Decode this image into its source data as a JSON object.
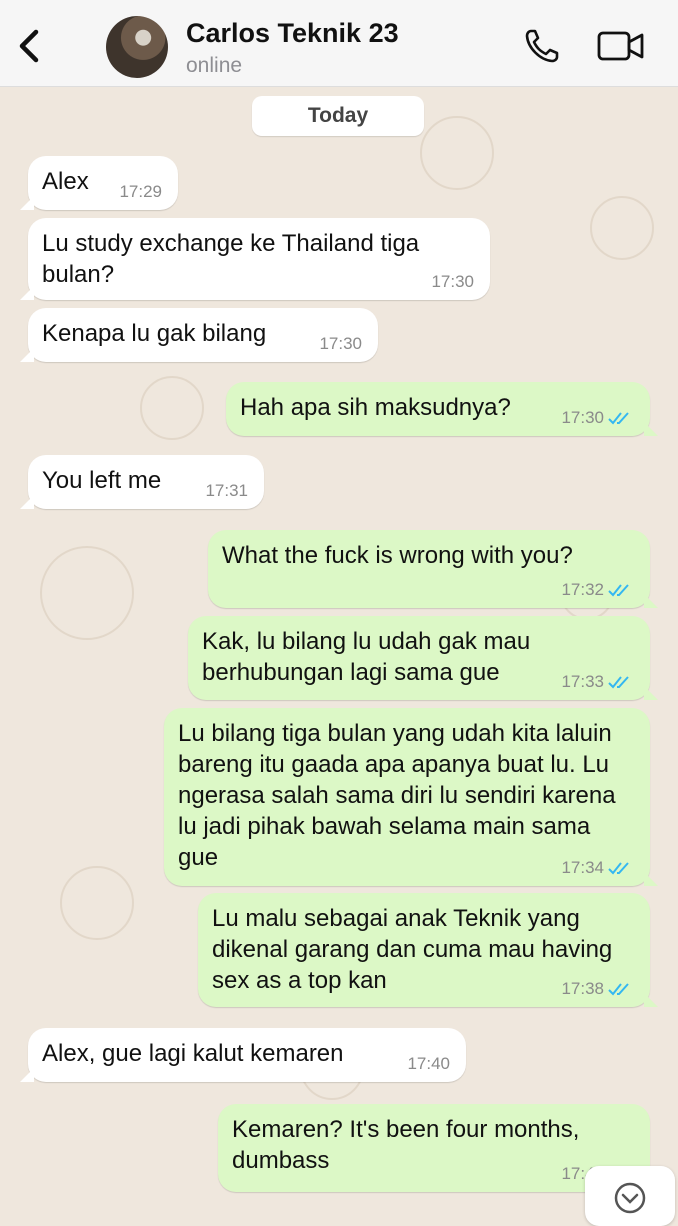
{
  "header": {
    "contact_name": "Carlos Teknik 23",
    "status": "online",
    "back_icon": "chevron-left-icon",
    "call_icon": "phone-icon",
    "video_icon": "video-camera-icon"
  },
  "date_separator": "Today",
  "colors": {
    "incoming_bubble": "#ffffff",
    "outgoing_bubble": "#dcf8c6",
    "read_ticks": "#34b7f1",
    "wallpaper": "#efe7dd"
  },
  "messages": [
    {
      "direction": "in",
      "text": "Alex",
      "time": "17:29"
    },
    {
      "direction": "in",
      "text": "Lu study exchange ke Thailand tiga bulan?",
      "time": "17:30"
    },
    {
      "direction": "in",
      "text": "Kenapa lu gak bilang",
      "time": "17:30"
    },
    {
      "direction": "out",
      "text": "Hah apa sih maksudnya?",
      "time": "17:30",
      "status": "read"
    },
    {
      "direction": "in",
      "text": "You left me",
      "time": "17:31"
    },
    {
      "direction": "out",
      "text": "What the fuck is wrong with you?",
      "time": "17:32",
      "status": "read"
    },
    {
      "direction": "out",
      "text": "Kak, lu bilang lu udah gak mau berhubungan lagi sama gue",
      "time": "17:33",
      "status": "read"
    },
    {
      "direction": "out",
      "text": "Lu bilang tiga bulan yang udah kita laluin bareng itu gaada apa apanya buat lu. Lu ngerasa salah sama diri lu sendiri karena lu jadi pihak bawah selama main sama gue",
      "time": "17:34",
      "status": "read"
    },
    {
      "direction": "out",
      "text": "Lu malu sebagai anak Teknik yang dikenal garang dan cuma mau having sex as a top kan",
      "time": "17:38",
      "status": "read"
    },
    {
      "direction": "in",
      "text": "Alex, gue lagi kalut kemaren",
      "time": "17:40"
    },
    {
      "direction": "out",
      "text": "Kemaren? It's been four months, dumbass",
      "time": "17:41",
      "status": "read"
    }
  ],
  "scroll_button_icon": "chevron-down-icon"
}
